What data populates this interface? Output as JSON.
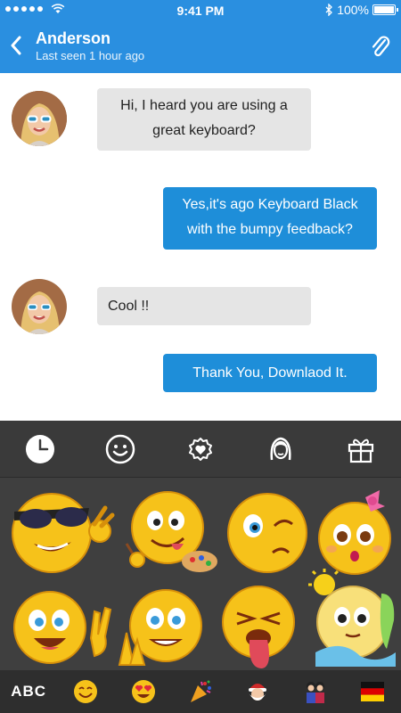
{
  "status_bar": {
    "time": "9:41 PM",
    "battery": "100%",
    "battery_level": 1.0
  },
  "header": {
    "contact_name": "Anderson",
    "last_seen": "Last seen 1 hour ago"
  },
  "messages": [
    {
      "direction": "in",
      "text": "Hi, I heard you are using a great keyboard?"
    },
    {
      "direction": "out",
      "text": "Yes,it's ago Keyboard Black with the bumpy feedback?"
    },
    {
      "direction": "in",
      "text": "Cool !!"
    },
    {
      "direction": "out",
      "text": "Thank You, Downlaod It."
    }
  ],
  "keyboard": {
    "bottom_label": "ABC",
    "colors": {
      "tab_bar": "#3a3a3a",
      "grid": "#3f3f3f",
      "bottom_bar": "#2e2e2e",
      "accent": "#2a8fe0"
    }
  }
}
